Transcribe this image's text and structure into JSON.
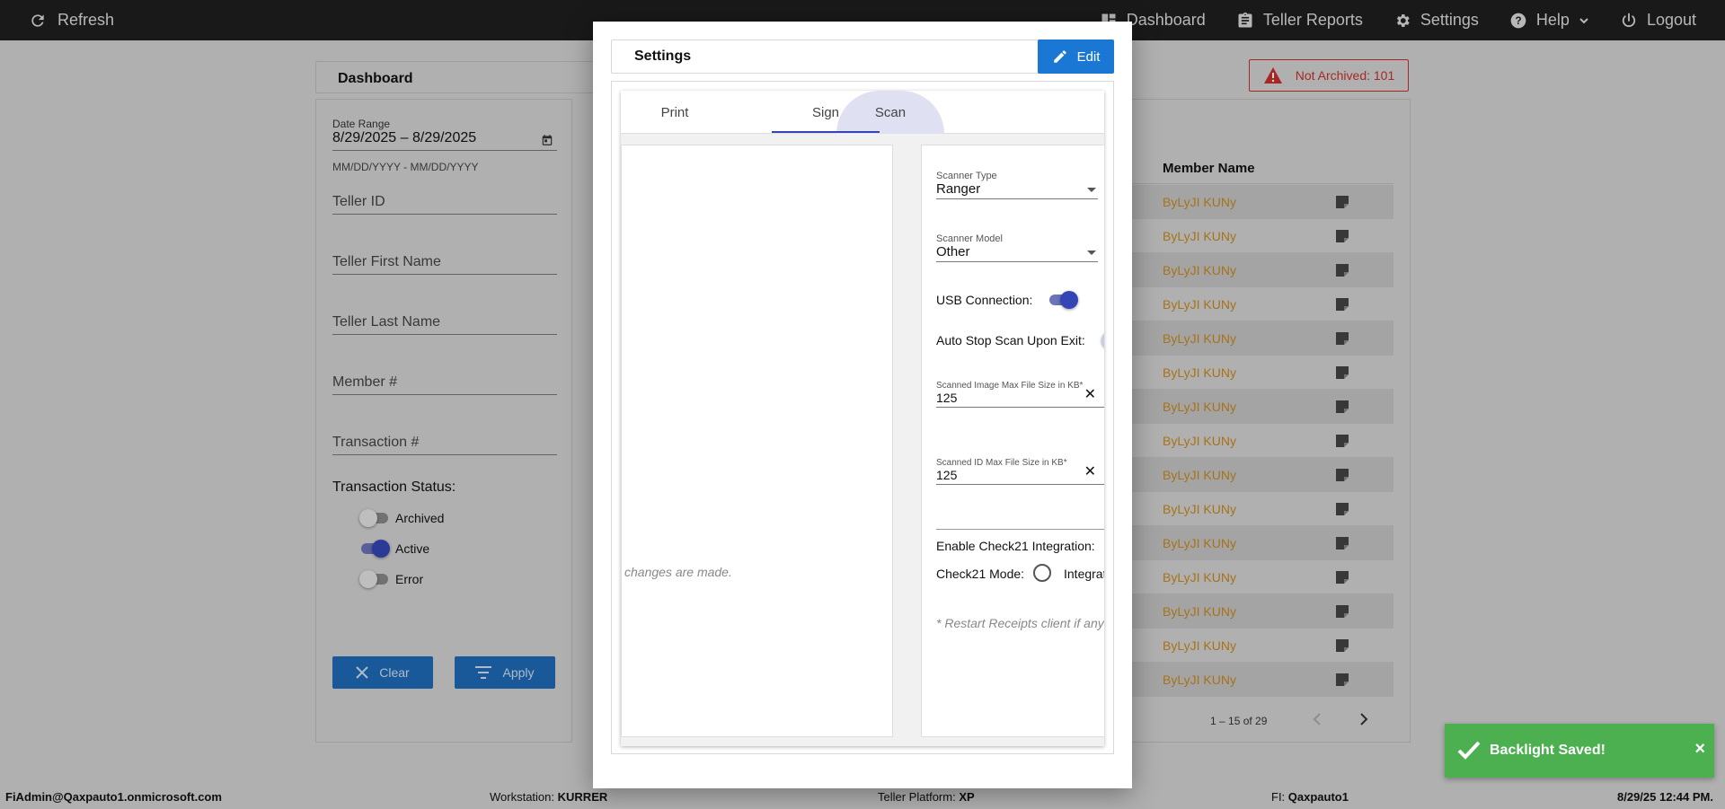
{
  "topbar": {
    "refresh_label": "Refresh",
    "nav": [
      {
        "label": "Dashboard",
        "icon": "dashboard-icon"
      },
      {
        "label": "Teller Reports",
        "icon": "clipboard-icon"
      },
      {
        "label": "Settings",
        "icon": "gear-icon"
      },
      {
        "label": "Help",
        "icon": "help-icon"
      },
      {
        "label": "Logout",
        "icon": "power-icon"
      }
    ]
  },
  "dashboard": {
    "title": "Dashboard",
    "filters": {
      "date_range_label": "Date Range",
      "date_range_value": "8/29/2025 – 8/29/2025",
      "date_hint": "MM/DD/YYYY - MM/DD/YYYY",
      "teller_id": "Teller ID",
      "teller_first_name": "Teller First Name",
      "teller_last_name": "Teller Last Name",
      "member_number": "Member #",
      "transaction_number": "Transaction #",
      "status_title": "Transaction Status:",
      "statuses": [
        {
          "label": "Archived",
          "on": false
        },
        {
          "label": "Active",
          "on": true
        },
        {
          "label": "Error",
          "on": false
        }
      ],
      "clear_label": "Clear",
      "apply_label": "Apply"
    },
    "not_archived": "Not Archived: 101",
    "table": {
      "member_name_header": "Member Name",
      "rows": [
        "ByLyJI KUNy",
        "ByLyJI KUNy",
        "ByLyJI KUNy",
        "ByLyJI KUNy",
        "ByLyJI KUNy",
        "ByLyJI KUNy",
        "ByLyJI KUNy",
        "ByLyJI KUNy",
        "ByLyJI KUNy",
        "ByLyJI KUNy",
        "ByLyJI KUNy",
        "ByLyJI KUNy",
        "ByLyJI KUNy",
        "ByLyJI KUNy",
        "ByLyJI KUNy"
      ],
      "pagination": "1 – 15 of 29"
    }
  },
  "statusbar": {
    "user": "FiAdmin@Qaxpauto1.onmicrosoft.com",
    "workstation_label": "Workstation:",
    "workstation": "KURRER",
    "platform_label": "Teller Platform:",
    "platform": "XP",
    "fi_label": "FI:",
    "fi": "Qaxpauto1",
    "datetime": "8/29/25 12:44 PM."
  },
  "modal": {
    "title": "Settings",
    "edit_label": "Edit",
    "tabs": [
      "Print",
      "Sign",
      "Scan"
    ],
    "left_note": "changes are made.",
    "scan": {
      "scanner_type_label": "Scanner Type",
      "scanner_type": "Ranger",
      "scanner_model_label": "Scanner Model",
      "scanner_model": "Other",
      "usb_label": "USB Connection:",
      "auto_stop_label": "Auto Stop Scan Upon Exit:",
      "image_max_label": "Scanned Image Max File Size in KB*",
      "image_max_value": "125",
      "id_max_label": "Scanned ID Max File Size in KB*",
      "id_max_value": "125",
      "check21_label": "Enable Check21 Integration:",
      "check21_mode_label": "Check21 Mode:",
      "check21_mode_option": "Integrat",
      "restart_note": "* Restart Receipts client if any"
    }
  },
  "toast": {
    "message": "Backlight Saved!",
    "close": "×"
  },
  "colors": {
    "topbar": "#1f1f1f",
    "primary": "#1a78d4",
    "toggle_on": "#3446b5",
    "member_name": "#c98a1e",
    "alert": "#c9302c",
    "toast": "#4caf50"
  }
}
